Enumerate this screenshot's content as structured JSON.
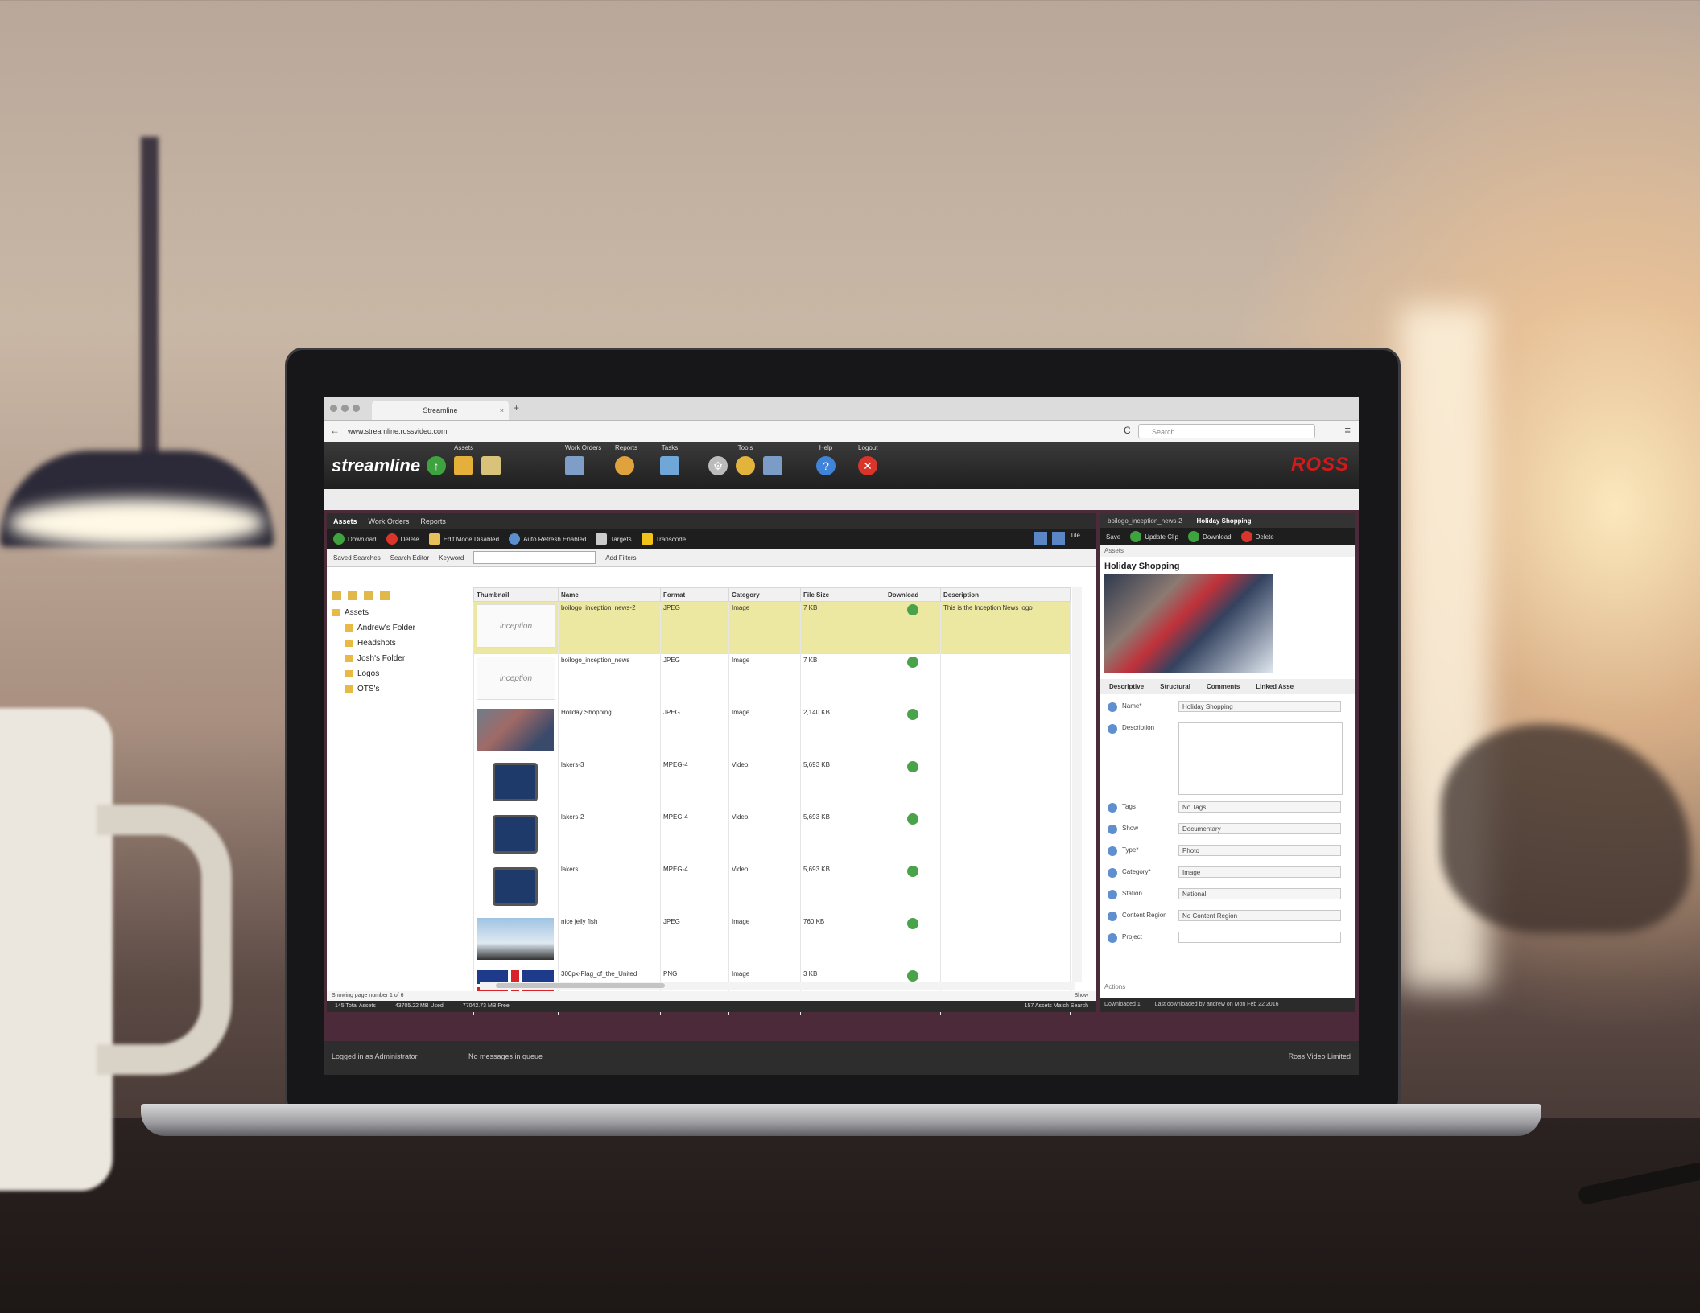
{
  "browser": {
    "tab_title": "Streamline",
    "tab_close": "×",
    "new_tab": "+",
    "back": "←",
    "url": "www.streamline.rossvideo.com",
    "reload": "C",
    "search_placeholder": "Search",
    "menu": "≡"
  },
  "app": {
    "logo": "streamline",
    "brand": "ROSS",
    "toolbar_groups": [
      {
        "label": "Assets"
      },
      {
        "label": "Work Orders"
      },
      {
        "label": "Reports"
      },
      {
        "label": "Tasks"
      },
      {
        "label": "Tools"
      },
      {
        "label": "Help"
      },
      {
        "label": "Logout"
      }
    ]
  },
  "assets_panel": {
    "tabs": [
      "Assets",
      "Work Orders",
      "Reports"
    ],
    "toolbar": {
      "download": "Download",
      "delete": "Delete",
      "edit_mode": "Edit Mode Disabled",
      "auto_refresh": "Auto Refresh Enabled",
      "targets": "Targets",
      "transcode": "Transcode",
      "tile": "Tile"
    },
    "searchbar": {
      "saved_searches": "Saved Searches",
      "search_editor": "Search Editor",
      "keyword_label": "Keyword",
      "add_filters": "Add Filters"
    },
    "tree": {
      "root": "Assets",
      "folders": [
        "Andrew's Folder",
        "Headshots",
        "Josh's Folder",
        "Logos",
        "OTS's"
      ]
    },
    "columns": [
      "Thumbnail",
      "Name",
      "Format",
      "Category",
      "File Size",
      "Download",
      "Description"
    ],
    "rows": [
      {
        "name": "boilogo_inception_news-2",
        "format": "JPEG",
        "category": "Image",
        "size": "7 KB",
        "description": "This is the Inception News logo"
      },
      {
        "name": "boilogo_inception_news",
        "format": "JPEG",
        "category": "Image",
        "size": "7 KB",
        "description": ""
      },
      {
        "name": "Holiday Shopping",
        "format": "JPEG",
        "category": "Image",
        "size": "2,140 KB",
        "description": ""
      },
      {
        "name": "lakers-3",
        "format": "MPEG-4",
        "category": "Video",
        "size": "5,693 KB",
        "description": ""
      },
      {
        "name": "lakers-2",
        "format": "MPEG-4",
        "category": "Video",
        "size": "5,693 KB",
        "description": ""
      },
      {
        "name": "lakers",
        "format": "MPEG-4",
        "category": "Video",
        "size": "5,693 KB",
        "description": ""
      },
      {
        "name": "nice jelly fish",
        "format": "JPEG",
        "category": "Image",
        "size": "760 KB",
        "description": ""
      },
      {
        "name": "300px-Flag_of_the_United",
        "format": "PNG",
        "category": "Image",
        "size": "3 KB",
        "description": ""
      }
    ],
    "pager": "Showing page number 1 of 6",
    "show_label": "Show",
    "status": {
      "total": "145 Total Assets",
      "used": "43705.22 MB Used",
      "free": "77042.73 MB Free",
      "match": "157 Assets Match Search"
    }
  },
  "details_panel": {
    "tabs": [
      "boilogo_inception_news-2",
      "Holiday Shopping"
    ],
    "toolbar": {
      "save": "Save",
      "update": "Update Clip",
      "download": "Download",
      "delete": "Delete"
    },
    "breadcrumb": "Assets",
    "title": "Holiday Shopping",
    "meta_tabs": [
      "Descriptive",
      "Structural",
      "Comments",
      "Linked Asse"
    ],
    "fields": [
      {
        "label": "Name*",
        "value": "Holiday Shopping"
      },
      {
        "label": "Description",
        "value": ""
      },
      {
        "label": "Tags",
        "value": "No Tags"
      },
      {
        "label": "Show",
        "value": "Documentary"
      },
      {
        "label": "Type*",
        "value": "Photo"
      },
      {
        "label": "Category*",
        "value": "Image"
      },
      {
        "label": "Station",
        "value": "National"
      },
      {
        "label": "Content Region",
        "value": "No Content Region"
      },
      {
        "label": "Project",
        "value": ""
      }
    ],
    "actions": "Actions",
    "status": {
      "downloaded": "Downloaded 1",
      "last": "Last downloaded by andrew on Mon Feb 22 2016"
    }
  },
  "footer": {
    "logged_in": "Logged in as Administrator",
    "messages": "No messages in queue",
    "copyright": "Ross Video Limited"
  },
  "colors": {
    "accent": "#d11a1a",
    "frame": "#4d2a3a",
    "selected_row": "#ece8a2"
  }
}
